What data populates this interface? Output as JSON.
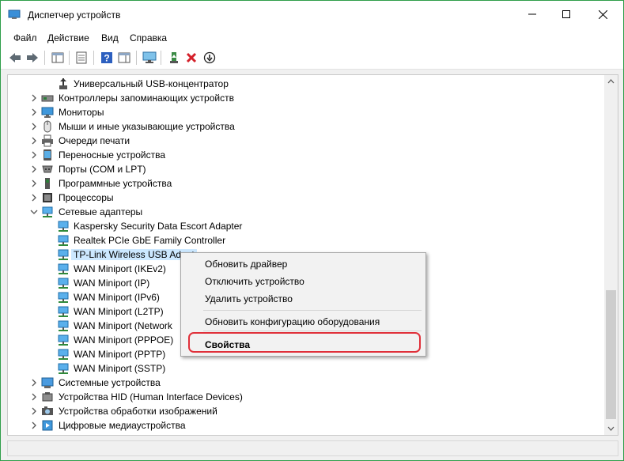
{
  "window": {
    "title": "Диспетчер устройств",
    "accent": "#2f9e4a"
  },
  "menubar": [
    "Файл",
    "Действие",
    "Вид",
    "Справка"
  ],
  "toolbar": {
    "icons": [
      "back-arrow-icon",
      "forward-arrow-icon",
      "show-hide-tree-icon",
      "properties-icon",
      "help-icon",
      "action-pane-icon",
      "monitor-scan-icon",
      "update-driver-icon",
      "uninstall-x-icon",
      "disable-device-icon"
    ]
  },
  "tree": [
    {
      "label": "Универсальный USB-концентратор",
      "level": 2,
      "expand": "none",
      "icon": "usb-icon"
    },
    {
      "label": "Контроллеры запоминающих устройств",
      "level": 1,
      "expand": "collapsed",
      "icon": "storage-controller-icon"
    },
    {
      "label": "Мониторы",
      "level": 1,
      "expand": "collapsed",
      "icon": "monitor-icon"
    },
    {
      "label": "Мыши и иные указывающие устройства",
      "level": 1,
      "expand": "collapsed",
      "icon": "mouse-icon"
    },
    {
      "label": "Очереди печати",
      "level": 1,
      "expand": "collapsed",
      "icon": "printer-icon"
    },
    {
      "label": "Переносные устройства",
      "level": 1,
      "expand": "collapsed",
      "icon": "portable-device-icon"
    },
    {
      "label": "Порты (COM и LPT)",
      "level": 1,
      "expand": "collapsed",
      "icon": "port-icon"
    },
    {
      "label": "Программные устройства",
      "level": 1,
      "expand": "collapsed",
      "icon": "software-device-icon"
    },
    {
      "label": "Процессоры",
      "level": 1,
      "expand": "collapsed",
      "icon": "processor-icon"
    },
    {
      "label": "Сетевые адаптеры",
      "level": 1,
      "expand": "expanded",
      "icon": "network-adapter-icon"
    },
    {
      "label": "Kaspersky Security Data Escort Adapter",
      "level": 2,
      "expand": "none",
      "icon": "network-adapter-icon"
    },
    {
      "label": "Realtek PCIe GbE Family Controller",
      "level": 2,
      "expand": "none",
      "icon": "network-adapter-icon"
    },
    {
      "label": "TP-Link Wireless USB Adapt",
      "level": 2,
      "expand": "none",
      "icon": "network-adapter-icon",
      "selected": true
    },
    {
      "label": "WAN Miniport (IKEv2)",
      "level": 2,
      "expand": "none",
      "icon": "network-adapter-icon"
    },
    {
      "label": "WAN Miniport (IP)",
      "level": 2,
      "expand": "none",
      "icon": "network-adapter-icon"
    },
    {
      "label": "WAN Miniport (IPv6)",
      "level": 2,
      "expand": "none",
      "icon": "network-adapter-icon"
    },
    {
      "label": "WAN Miniport (L2TP)",
      "level": 2,
      "expand": "none",
      "icon": "network-adapter-icon"
    },
    {
      "label": "WAN Miniport (Network",
      "level": 2,
      "expand": "none",
      "icon": "network-adapter-icon"
    },
    {
      "label": "WAN Miniport (PPPOE)",
      "level": 2,
      "expand": "none",
      "icon": "network-adapter-icon"
    },
    {
      "label": "WAN Miniport (PPTP)",
      "level": 2,
      "expand": "none",
      "icon": "network-adapter-icon"
    },
    {
      "label": "WAN Miniport (SSTP)",
      "level": 2,
      "expand": "none",
      "icon": "network-adapter-icon"
    },
    {
      "label": "Системные устройства",
      "level": 1,
      "expand": "collapsed",
      "icon": "system-device-icon"
    },
    {
      "label": "Устройства HID (Human Interface Devices)",
      "level": 1,
      "expand": "collapsed",
      "icon": "hid-icon"
    },
    {
      "label": "Устройства обработки изображений",
      "level": 1,
      "expand": "collapsed",
      "icon": "imaging-device-icon"
    },
    {
      "label": "Цифровые медиаустройства",
      "level": 1,
      "expand": "collapsed",
      "icon": "media-device-icon"
    }
  ],
  "context_menu": {
    "update_driver": "Обновить драйвер",
    "disable_device": "Отключить устройство",
    "uninstall_device": "Удалить устройство",
    "scan_hardware": "Обновить конфигурацию оборудования",
    "properties": "Свойства",
    "highlight_color": "#e0303a"
  }
}
